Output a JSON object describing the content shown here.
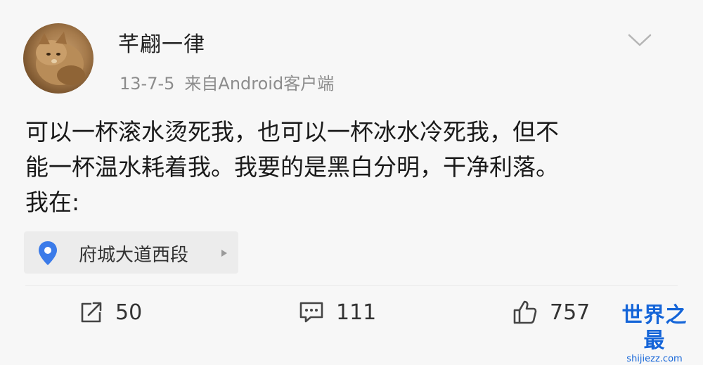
{
  "post": {
    "author": {
      "name": "芊翩一律",
      "avatar_icon": "cat-avatar"
    },
    "meta": {
      "date": "13-7-5",
      "source": "来自Android客户端"
    },
    "menu_icon": "chevron-down-icon",
    "body_lines": [
      "可以一杯滚水烫死我，也可以一杯冰水冷死我，但不",
      "能一杯温水耗着我。我要的是黑白分明，干净利落。",
      "我在:"
    ],
    "location": {
      "icon": "location-pin-icon",
      "label": "府城大道西段",
      "accent": "#3b7be9"
    },
    "actions": {
      "repost": {
        "icon": "repost-icon",
        "count": "50"
      },
      "comment": {
        "icon": "comment-icon",
        "count": "111"
      },
      "like": {
        "icon": "thumbs-up-icon",
        "count": "757"
      }
    }
  },
  "watermark": {
    "title": "世界之最",
    "url": "shijiezz.com",
    "color": "#1565d8"
  }
}
